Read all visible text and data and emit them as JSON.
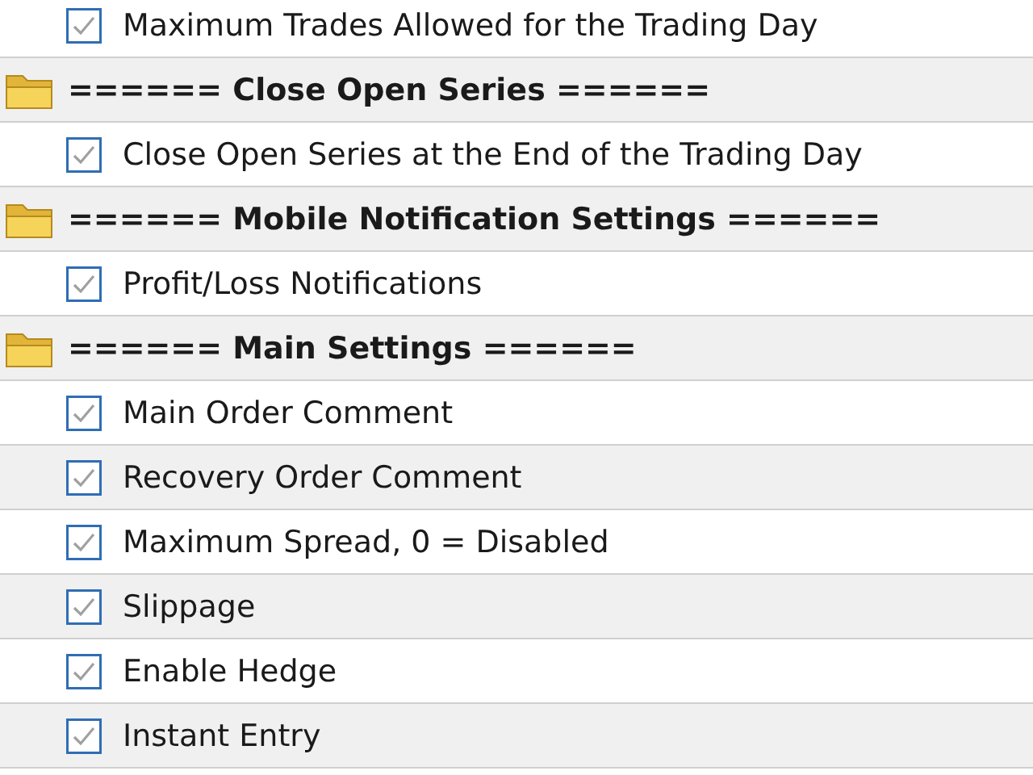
{
  "rows": [
    {
      "kind": "param",
      "label": "Maximum Trades Allowed for the Trading Day",
      "checked": true
    },
    {
      "kind": "group",
      "label": "====== Close Open Series ======"
    },
    {
      "kind": "param",
      "label": "Close Open Series at the End of the Trading Day",
      "checked": true
    },
    {
      "kind": "group",
      "label": "====== Mobile Notification Settings ======"
    },
    {
      "kind": "param",
      "label": "Profit/Loss Notifications",
      "checked": true
    },
    {
      "kind": "group",
      "label": "====== Main Settings ======"
    },
    {
      "kind": "param",
      "label": "Main Order Comment",
      "checked": true
    },
    {
      "kind": "param",
      "label": "Recovery Order Comment",
      "checked": true
    },
    {
      "kind": "param",
      "label": "Maximum Spread, 0 = Disabled",
      "checked": true
    },
    {
      "kind": "param",
      "label": "Slippage",
      "checked": true
    },
    {
      "kind": "param",
      "label": "Enable Hedge",
      "checked": true
    },
    {
      "kind": "param",
      "label": "Instant Entry",
      "checked": true
    }
  ]
}
